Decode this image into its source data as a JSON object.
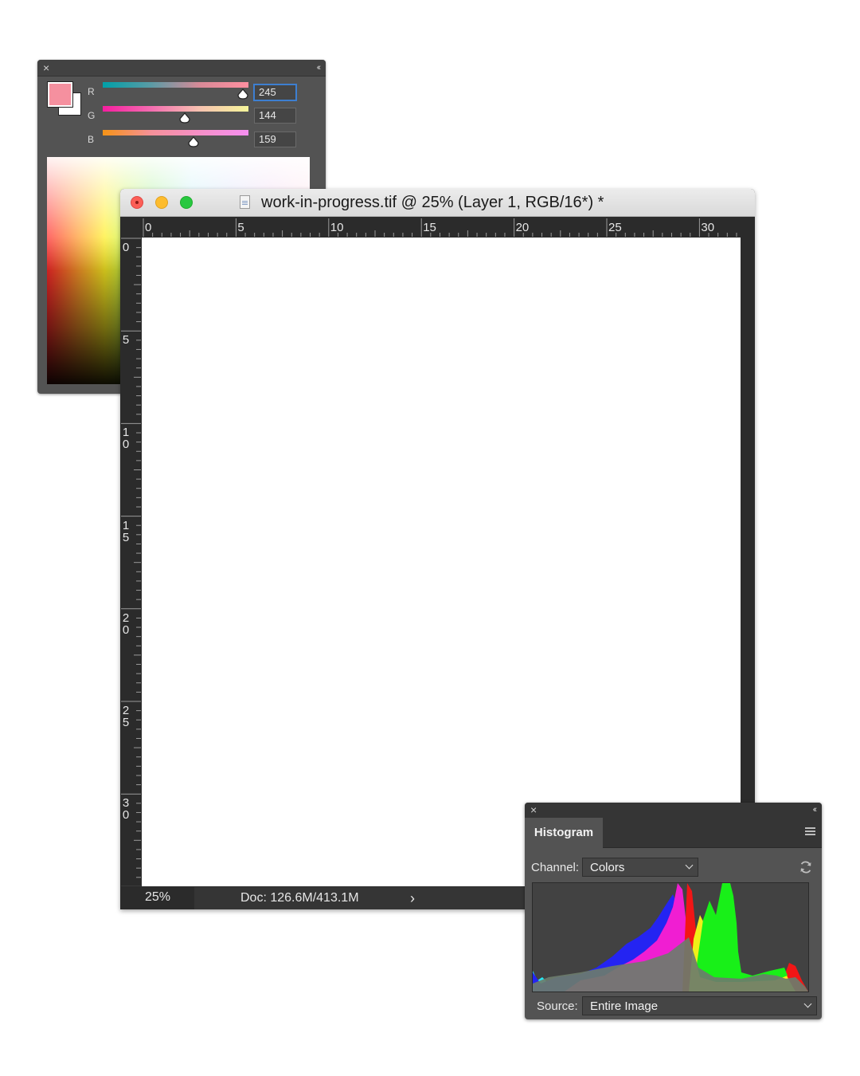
{
  "color_panel": {
    "foreground_color": "#f5909f",
    "background_color": "#ffffff",
    "channels": [
      {
        "label": "R",
        "value": "245",
        "level": 0.96
      },
      {
        "label": "G",
        "value": "144",
        "level": 0.565
      },
      {
        "label": "B",
        "value": "159",
        "level": 0.624
      }
    ]
  },
  "document": {
    "title": "work-in-progress.tif @ 25% (Layer 1, RGB/16*) *",
    "h_ruler_labels": [
      "0",
      "5",
      "10",
      "15",
      "20",
      "25",
      "30"
    ],
    "v_ruler_labels": [
      [
        "0"
      ],
      [
        "5"
      ],
      [
        "1",
        "0"
      ],
      [
        "1",
        "5"
      ],
      [
        "2",
        "0"
      ],
      [
        "2",
        "5"
      ],
      [
        "3",
        "0"
      ]
    ],
    "status": {
      "zoom": "25%",
      "doc_info": "Doc: 126.6M/413.1M",
      "arrow": "›"
    }
  },
  "histogram": {
    "tab_label": "Histogram",
    "channel_label": "Channel:",
    "channel_value": "Colors",
    "source_label": "Source:",
    "source_value": "Entire Image"
  }
}
